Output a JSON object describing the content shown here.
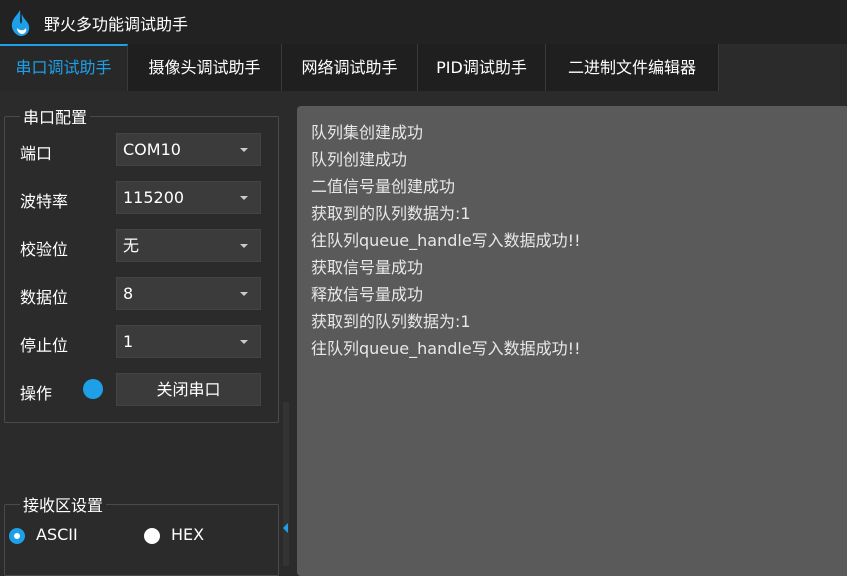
{
  "window": {
    "title": "野火多功能调试助手"
  },
  "tabs": [
    {
      "label": "串口调试助手",
      "active": true
    },
    {
      "label": "摄像头调试助手",
      "active": false
    },
    {
      "label": "网络调试助手",
      "active": false
    },
    {
      "label": "PID调试助手",
      "active": false
    },
    {
      "label": "二进制文件编辑器",
      "active": false
    }
  ],
  "serial_config": {
    "title": "串口配置",
    "port": {
      "label": "端口",
      "value": "COM10"
    },
    "baud": {
      "label": "波特率",
      "value": "115200"
    },
    "parity": {
      "label": "校验位",
      "value": "无"
    },
    "data_bits": {
      "label": "数据位",
      "value": "8"
    },
    "stop_bits": {
      "label": "停止位",
      "value": "1"
    },
    "operation": {
      "label": "操作",
      "button": "关闭串口",
      "status_color": "#1ea0e8"
    }
  },
  "receive_settings": {
    "title": "接收区设置",
    "ascii_label": "ASCII",
    "hex_label": "HEX",
    "selected": "ASCII"
  },
  "receive_log": [
    "队列集创建成功",
    "队列创建成功",
    "二值信号量创建成功",
    "获取到的队列数据为:1",
    "往队列queue_handle写入数据成功!!",
    "获取信号量成功",
    "释放信号量成功",
    "获取到的队列数据为:1",
    "往队列queue_handle写入数据成功!!"
  ],
  "colors": {
    "accent": "#1ea0e8",
    "background": "#2b2b2b",
    "receive_bg": "#5a5a5a"
  }
}
